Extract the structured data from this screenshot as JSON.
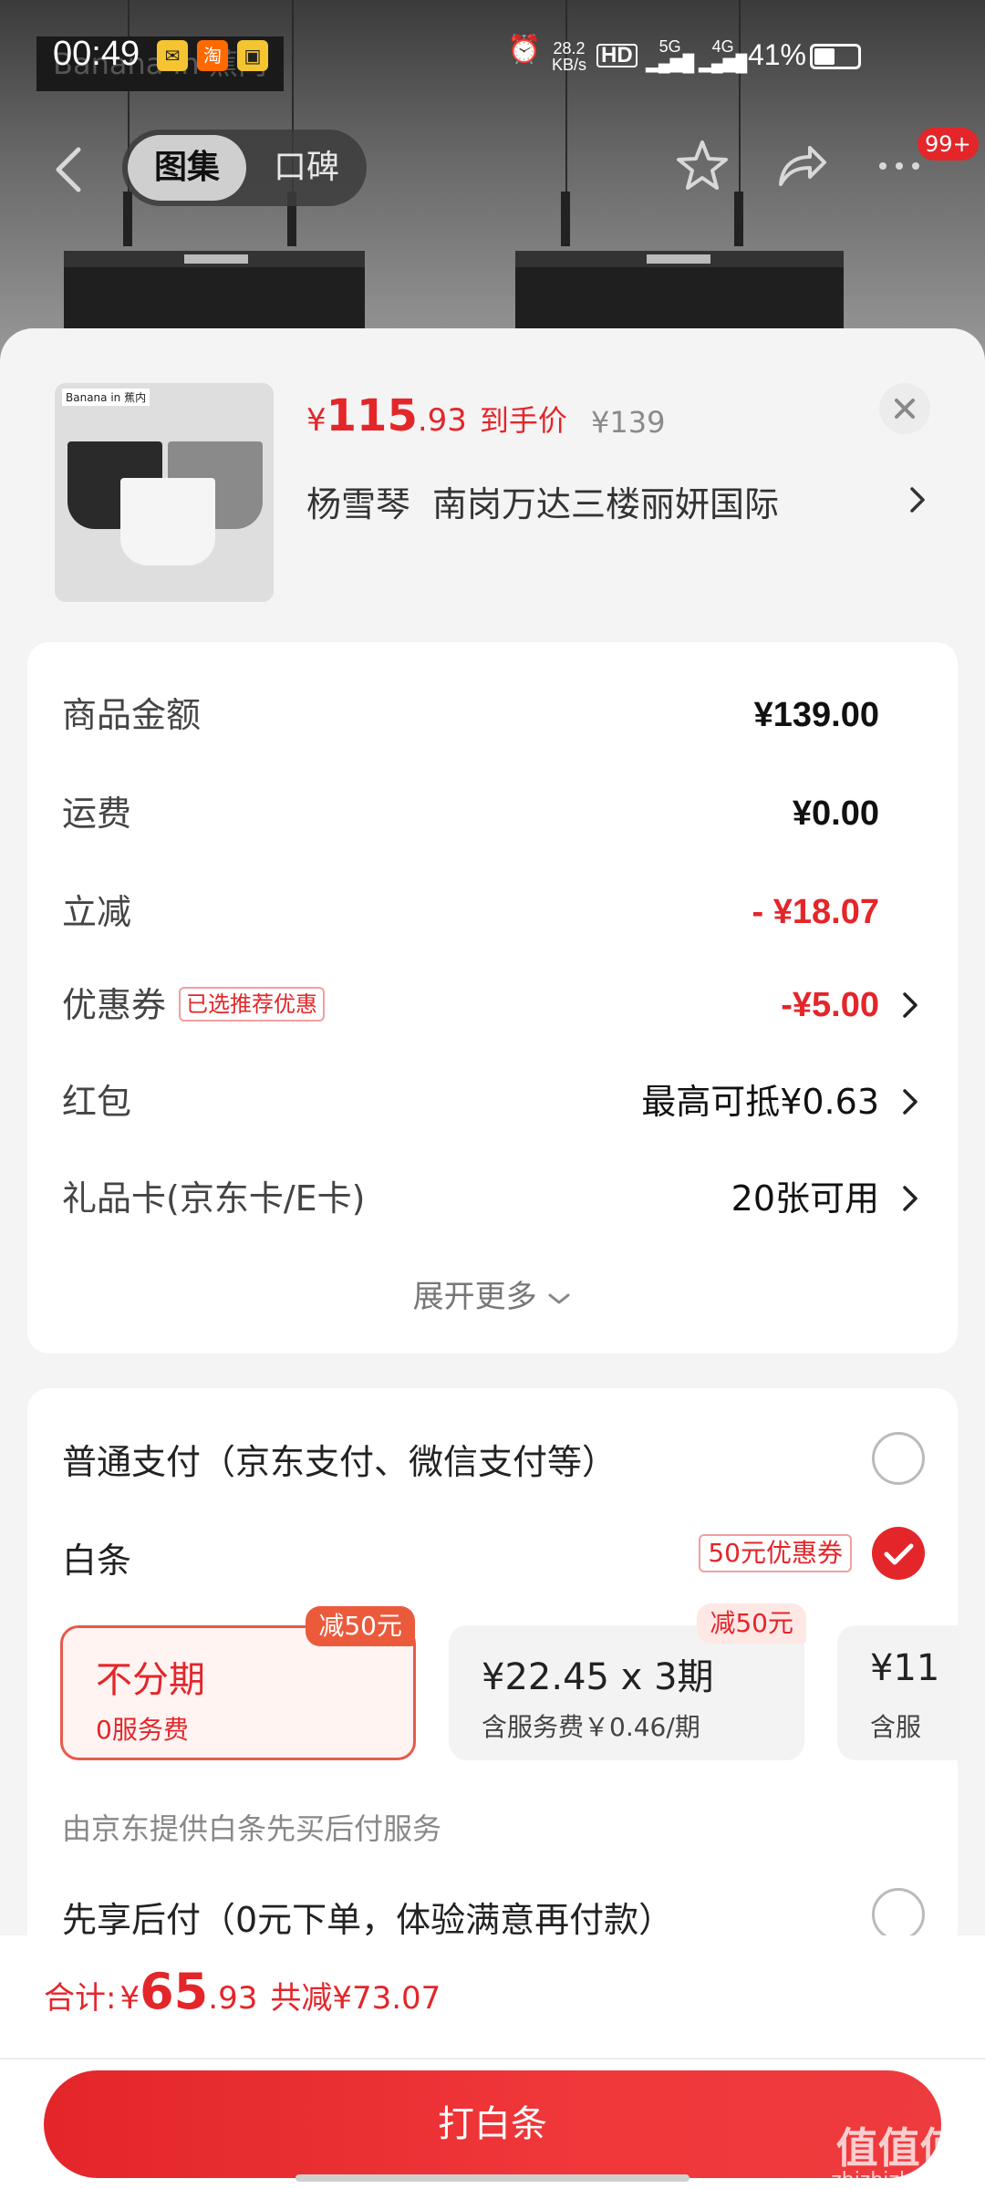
{
  "status_bar": {
    "time": "00:49",
    "net_speed_value": "28.2",
    "net_speed_unit": "KB/s",
    "hd_label": "HD",
    "signal_5g": "5G",
    "signal_4g": "4G",
    "battery": "41%"
  },
  "background": {
    "brand_text": "Banana in 蕉内"
  },
  "nav": {
    "tabs": [
      "图集",
      "口碑"
    ],
    "active_tab": "图集",
    "more_badge": "99+"
  },
  "product": {
    "thumb_brand": "Banana in 蕉内",
    "price_yen": "¥",
    "price_int": "115",
    "price_dec": ".93",
    "price_label": "到手价",
    "original_price": "¥139"
  },
  "address": {
    "name": "杨雪琴",
    "detail": "南岗万达三楼丽妍国际"
  },
  "summary": {
    "rows": [
      {
        "label": "商品金额",
        "value": "¥139.00"
      },
      {
        "label": "运费",
        "value": "¥0.00"
      },
      {
        "label": "立减",
        "value": "- ¥18.07"
      },
      {
        "label": "优惠券",
        "tag": "已选推荐优惠",
        "value": "-¥5.00"
      },
      {
        "label": "红包",
        "value": "最高可抵¥0.63"
      },
      {
        "label": "礼品卡(京东卡/E卡)",
        "value": "20张可用"
      }
    ],
    "expand_label": "展开更多"
  },
  "payment": {
    "normal_label": "普通支付（京东支付、微信支付等）",
    "baitiao_label": "白条",
    "baitiao_coupon": "50元优惠券",
    "plans": [
      {
        "title": "不分期",
        "sub": "0服务费",
        "badge": "减50元"
      },
      {
        "title": "¥22.45 x 3期",
        "sub": "含服务费￥0.46/期",
        "badge": "减50元"
      },
      {
        "title": "¥11",
        "sub": "含服"
      }
    ],
    "service_note": "由京东提供白条先买后付服务",
    "paylater_label": "先享后付（0元下单，体验满意再付款）"
  },
  "footer": {
    "total_label": "合计:",
    "total_yen": "¥",
    "total_int": "65",
    "total_dec": ".93",
    "saved": "共减¥73.07",
    "cta": "打白条"
  },
  "watermark": {
    "text": "值值值",
    "domain": "zhizhizhi.com"
  },
  "colors": {
    "accent": "#e3262a",
    "sheet_bg": "#f4f4f4",
    "card_bg": "#ffffff"
  },
  "icons": [
    "back-icon",
    "star-icon",
    "share-icon",
    "more-icon",
    "close-icon",
    "chevron-right-icon",
    "chevron-down-icon",
    "check-icon"
  ]
}
